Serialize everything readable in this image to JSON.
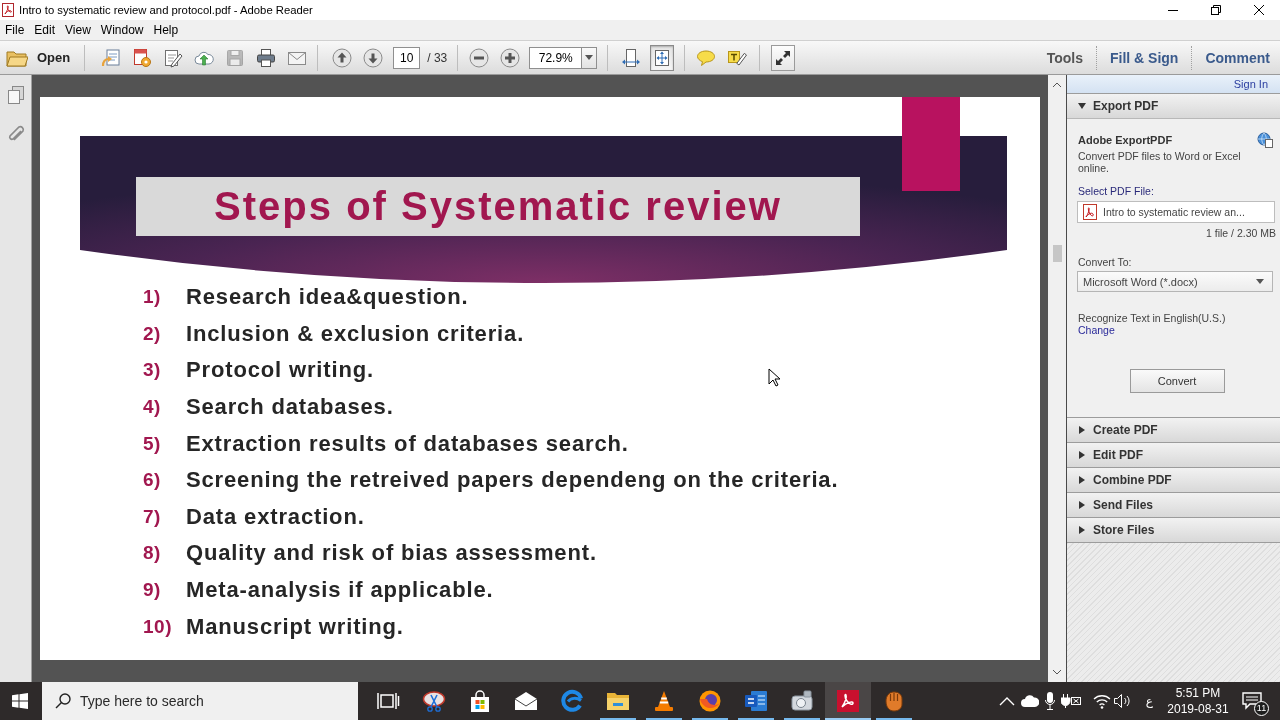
{
  "window": {
    "title": "Intro to systematic review and protocol.pdf - Adobe Reader"
  },
  "menu": [
    "File",
    "Edit",
    "View",
    "Window",
    "Help"
  ],
  "toolbar": {
    "open_label": "Open",
    "file_buttons": [
      {
        "kind": "create",
        "disabled": false
      },
      {
        "kind": "export",
        "disabled": false
      },
      {
        "kind": "edit",
        "disabled": false
      },
      {
        "kind": "upload",
        "disabled": false
      },
      {
        "kind": "save",
        "disabled": true
      },
      {
        "kind": "print",
        "disabled": false
      },
      {
        "kind": "email",
        "disabled": false
      }
    ],
    "page_number": "10",
    "page_count": "/ 33",
    "zoom": "72.9%",
    "view_buttons": [
      {
        "kind": "fit-width",
        "selected": false
      },
      {
        "kind": "fit-page",
        "selected": true
      }
    ],
    "tabs": [
      {
        "label": "Tools",
        "selected": true
      },
      {
        "label": "Fill & Sign",
        "selected": false
      },
      {
        "label": "Comment",
        "selected": false
      }
    ]
  },
  "document": {
    "title": "Steps of Systematic review",
    "steps": [
      {
        "number": "1)",
        "text": "Research idea&question."
      },
      {
        "number": "2)",
        "text": "Inclusion & exclusion criteria."
      },
      {
        "number": "3)",
        "text": "Protocol writing."
      },
      {
        "number": "4)",
        "text": "Search databases."
      },
      {
        "number": "5)",
        "text": "Extraction results of databases search."
      },
      {
        "number": "6)",
        "text": "Screening the retreived papers dependeng on the criteria."
      },
      {
        "number": "7)",
        "text": "Data extraction."
      },
      {
        "number": "8)",
        "text": "Quality and risk of bias assessment."
      },
      {
        "number": "9)",
        "text": "Meta-analysis if applicable."
      },
      {
        "number": "10)",
        "text": "Manuscript writing."
      }
    ]
  },
  "right_pane": {
    "sign_in": "Sign In",
    "panels": [
      {
        "label": "Export PDF",
        "expanded": true,
        "content": {
          "service_title": "Adobe ExportPDF",
          "description": "Convert PDF files to Word or Excel online.",
          "select_label": "Select PDF File:",
          "file_name": "Intro to systematic review an...",
          "file_info": "1 file / 2.30 MB",
          "convert_to_label": "Convert To:",
          "convert_to_value": "Microsoft Word (*.docx)",
          "recognize_text": "Recognize Text in English(U.S.)",
          "change_link": "Change",
          "convert_button": "Convert"
        }
      },
      {
        "label": "Create PDF",
        "expanded": false
      },
      {
        "label": "Edit PDF",
        "expanded": false
      },
      {
        "label": "Combine PDF",
        "expanded": false
      },
      {
        "label": "Send Files",
        "expanded": false
      },
      {
        "label": "Store Files",
        "expanded": false
      }
    ]
  },
  "taskbar": {
    "search_placeholder": "Type here to search",
    "apps": [
      {
        "kind": "task-view",
        "running": false,
        "active": false
      },
      {
        "kind": "snipping",
        "running": false,
        "active": false
      },
      {
        "kind": "store",
        "running": false,
        "active": false
      },
      {
        "kind": "mail",
        "running": false,
        "active": false
      },
      {
        "kind": "edge",
        "running": false,
        "active": false
      },
      {
        "kind": "explorer",
        "running": true,
        "active": false
      },
      {
        "kind": "vlc",
        "running": true,
        "active": false
      },
      {
        "kind": "firefox",
        "running": true,
        "active": false
      },
      {
        "kind": "word",
        "running": true,
        "active": false
      },
      {
        "kind": "drive",
        "running": true,
        "active": false
      },
      {
        "kind": "acrobat",
        "running": true,
        "active": true
      },
      {
        "kind": "glove",
        "running": true,
        "active": false
      }
    ],
    "tray": {
      "input_language": "ع",
      "time": "5:51 PM",
      "date": "2019-08-31",
      "notifications": "11"
    }
  }
}
